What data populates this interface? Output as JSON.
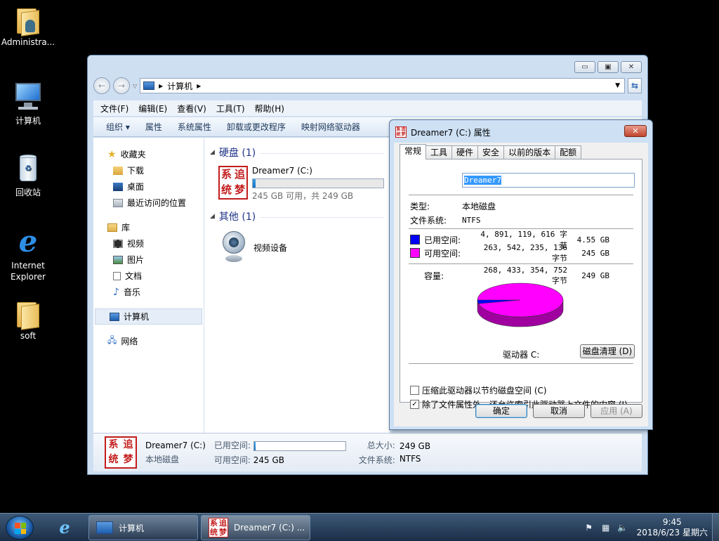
{
  "desktop": {
    "icons": [
      {
        "label": "Administra..."
      },
      {
        "label": "计算机"
      },
      {
        "label": "回收站"
      },
      {
        "label": "Internet Explorer"
      },
      {
        "label": "soft"
      }
    ]
  },
  "explorer": {
    "breadcrumb": [
      "计算机"
    ],
    "menu": [
      "文件(F)",
      "编辑(E)",
      "查看(V)",
      "工具(T)",
      "帮助(H)"
    ],
    "toolbar": [
      "组织 ▾",
      "属性",
      "系统属性",
      "卸载或更改程序",
      "映射网络驱动器"
    ],
    "nav": {
      "favorites": "收藏夹",
      "favorites_items": [
        "下载",
        "桌面",
        "最近访问的位置"
      ],
      "libraries": "库",
      "library_items": [
        "视频",
        "图片",
        "文档",
        "音乐"
      ],
      "computer": "计算机",
      "network": "网络"
    },
    "groups": {
      "hdd": "硬盘 (1)",
      "other": "其他 (1)"
    },
    "drive": {
      "name": "Dreamer7 (C:)",
      "free_text": "245 GB 可用，共 249 GB",
      "used_fraction": 0.02
    },
    "other_device": "视频设备",
    "logo_chars": [
      "系",
      "追",
      "统",
      "梦"
    ],
    "details": {
      "name": "Dreamer7 (C:)",
      "type": "本地磁盘",
      "used_label": "已用空间:",
      "free_label": "可用空间:",
      "free_value": "245 GB",
      "total_label": "总大小:",
      "total_value": "249 GB",
      "fs_label": "文件系统:",
      "fs_value": "NTFS"
    }
  },
  "dialog": {
    "title": "Dreamer7 (C:) 属性",
    "tabs": [
      "常规",
      "工具",
      "硬件",
      "安全",
      "以前的版本",
      "配额"
    ],
    "volume_label": "Dreamer7",
    "type_label": "类型:",
    "type_value": "本地磁盘",
    "fs_label": "文件系统:",
    "fs_value": "NTFS",
    "used": {
      "label": "已用空间:",
      "bytes": "4, 891, 119, 616 字节",
      "size": "4.55 GB",
      "color": "#0000ff"
    },
    "free": {
      "label": "可用空间:",
      "bytes": "263, 542, 235, 136 字节",
      "size": "245 GB",
      "color": "#ff00ff"
    },
    "capacity": {
      "label": "容量:",
      "bytes": "268, 433, 354, 752 字节",
      "size": "249 GB"
    },
    "drive_label": "驱动器 C:",
    "cleanup_button": "磁盘清理 (D)",
    "used_fraction": 0.0182,
    "compress_label": "压缩此驱动器以节约磁盘空间 (C)",
    "compress_checked": false,
    "index_label": "除了文件属性外，还允许索引此驱动器上文件的内容 (I)",
    "index_checked": true,
    "ok": "确定",
    "cancel": "取消",
    "apply": "应用 (A)"
  },
  "taskbar": {
    "tasks": [
      "计算机",
      "Dreamer7 (C:) ..."
    ],
    "time": "9:45",
    "date": "2018/6/23 星期六"
  }
}
